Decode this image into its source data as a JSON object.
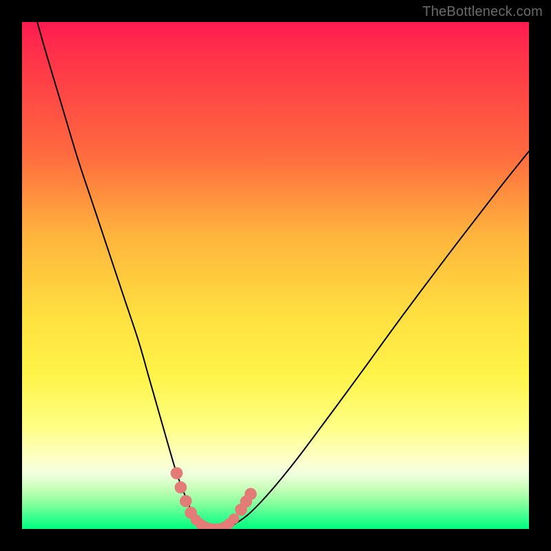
{
  "watermark": "TheBottleneck.com",
  "colors": {
    "curve": "#000000",
    "marker_fill": "#e37b77",
    "marker_stroke": "#d96660",
    "background_black": "#000000"
  },
  "chart_data": {
    "type": "line",
    "title": "",
    "xlabel": "",
    "ylabel": "",
    "xlim": [
      0,
      100
    ],
    "ylim": [
      0,
      100
    ],
    "grid": false,
    "legend": false,
    "series": [
      {
        "name": "bottleneck-curve",
        "x": [
          3,
          5,
          8,
          11,
          14,
          17,
          20,
          23,
          25,
          27,
          29,
          30.5,
          32,
          33,
          34,
          35,
          36,
          37,
          38,
          40,
          42,
          45,
          49,
          54,
          60,
          67,
          75,
          84,
          94,
          100
        ],
        "y": [
          100,
          93,
          83,
          73,
          64,
          55,
          46,
          37,
          30,
          23,
          16,
          11,
          7,
          4.5,
          2.6,
          1.4,
          0.6,
          0.2,
          0,
          0.1,
          1.0,
          3.2,
          7.4,
          13.5,
          21.5,
          31.0,
          42.0,
          54.0,
          67.0,
          74.5
        ]
      }
    ],
    "markers": [
      {
        "x": 30.5,
        "y": 11.0,
        "r": 1.2
      },
      {
        "x": 31.3,
        "y": 8.2,
        "r": 1.2
      },
      {
        "x": 32.3,
        "y": 5.5,
        "r": 1.2
      },
      {
        "x": 33.3,
        "y": 3.2,
        "r": 1.2
      },
      {
        "x": 34.3,
        "y": 1.8,
        "r": 1.06
      },
      {
        "x": 35.2,
        "y": 1.0,
        "r": 1.06
      },
      {
        "x": 36.1,
        "y": 0.45,
        "r": 1.06
      },
      {
        "x": 37.0,
        "y": 0.15,
        "r": 1.06
      },
      {
        "x": 38.0,
        "y": 0.05,
        "r": 1.06
      },
      {
        "x": 39.0,
        "y": 0.1,
        "r": 1.06
      },
      {
        "x": 40.0,
        "y": 0.45,
        "r": 1.06
      },
      {
        "x": 40.9,
        "y": 1.1,
        "r": 1.06
      },
      {
        "x": 41.8,
        "y": 2.0,
        "r": 1.06
      },
      {
        "x": 43.2,
        "y": 3.8,
        "r": 1.2
      },
      {
        "x": 44.2,
        "y": 5.4,
        "r": 1.2
      },
      {
        "x": 45.1,
        "y": 6.9,
        "r": 1.2
      }
    ]
  }
}
